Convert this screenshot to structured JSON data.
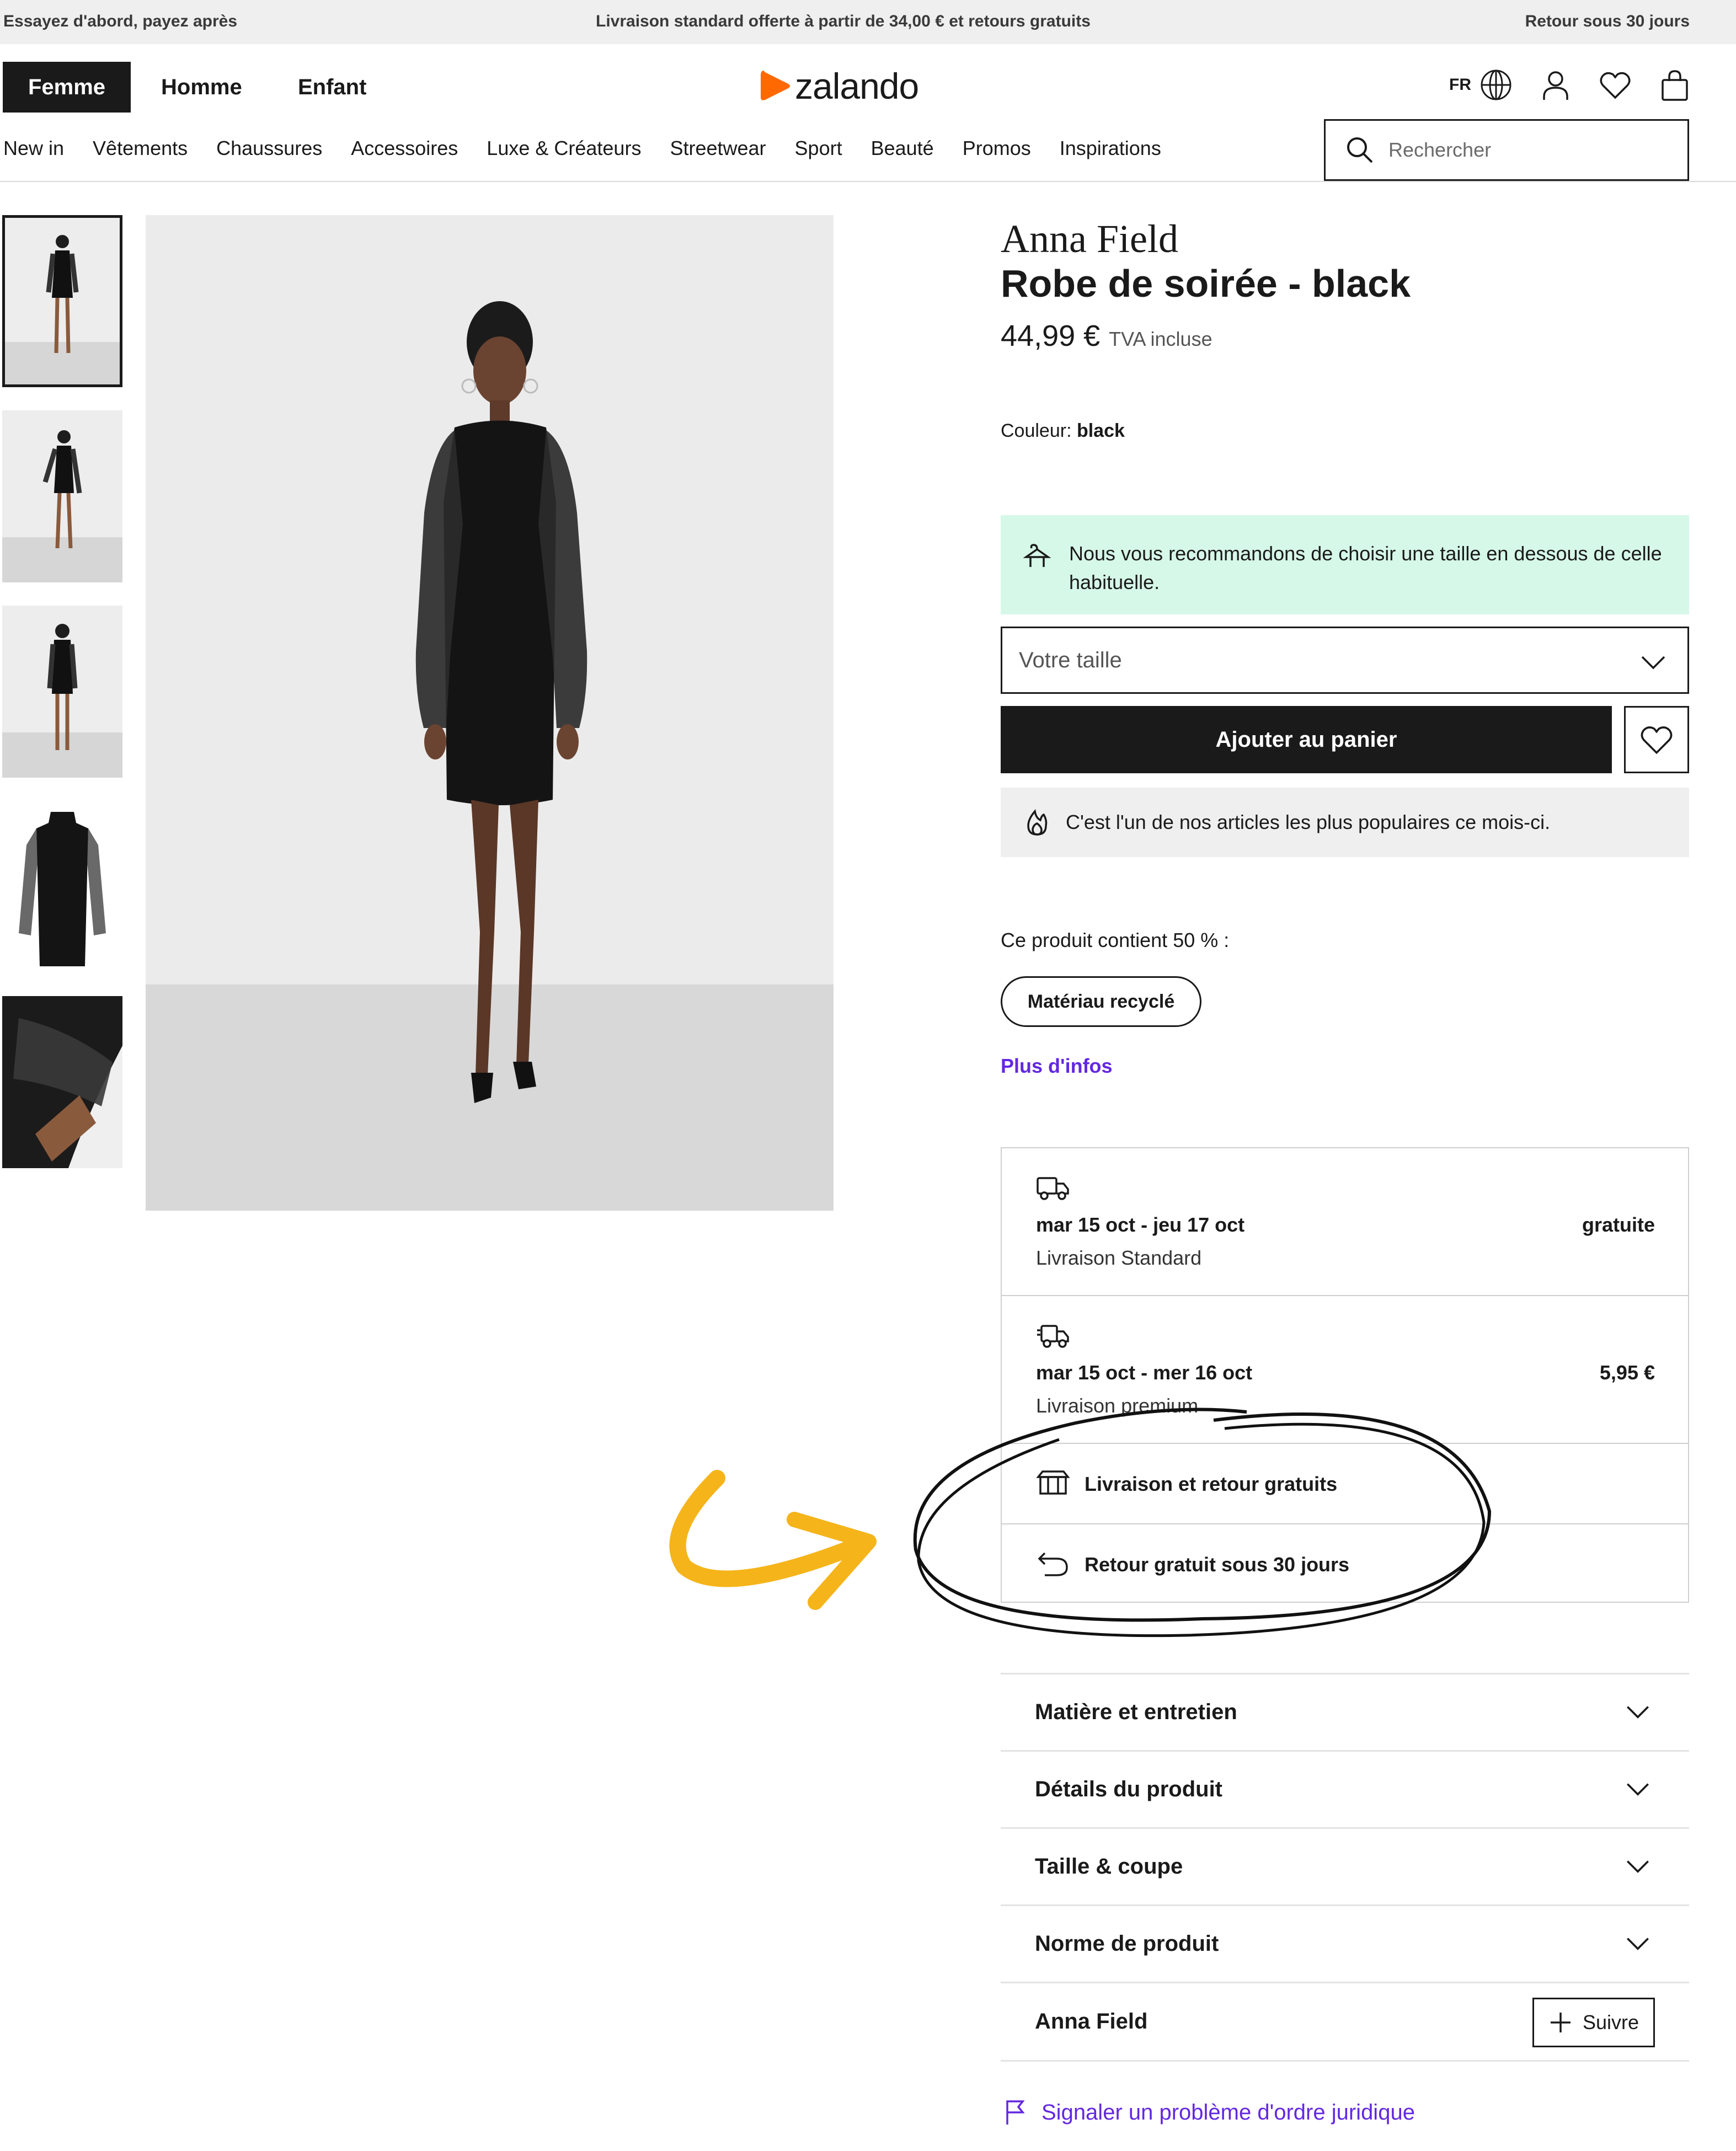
{
  "promo_bar": {
    "left": "Essayez d'abord, payez après",
    "center": "Livraison standard offerte à partir de 34,00 € et retours gratuits",
    "right": "Retour sous 30 jours"
  },
  "header": {
    "genders": [
      "Femme",
      "Homme",
      "Enfant"
    ],
    "active_gender": "Femme",
    "logo_text": "zalando",
    "language": "FR",
    "brand_color": "#ff6900",
    "icons": [
      "globe-icon",
      "account-icon",
      "wishlist-icon",
      "bag-icon"
    ]
  },
  "nav": {
    "items": [
      "New in",
      "Vêtements",
      "Chaussures",
      "Accessoires",
      "Luxe & Créateurs",
      "Streetwear",
      "Sport",
      "Beauté",
      "Promos",
      "Inspirations"
    ]
  },
  "search": {
    "placeholder": "Rechercher"
  },
  "gallery": {
    "thumbnail_count": 5,
    "selected_index": 0
  },
  "product": {
    "brand": "Anna Field",
    "name": "Robe de soirée - black",
    "price": "44,99 €",
    "tax_note": "TVA incluse",
    "color_label": "Couleur:",
    "color_value": "black"
  },
  "size_advice": {
    "text": "Nous vous recommandons de choisir une taille en dessous de celle habituelle.",
    "bg_color": "#d6f8e8"
  },
  "size_select": {
    "placeholder": "Votre taille"
  },
  "cart": {
    "add_label": "Ajouter au panier"
  },
  "popular": {
    "text": "C'est l'un de nos articles les plus populaires ce mois-ci."
  },
  "sustainability": {
    "contains": "Ce produit contient 50 % :",
    "chip": "Matériau recyclé",
    "more_link": "Plus d'infos",
    "link_color": "#6328e0"
  },
  "delivery": {
    "options": [
      {
        "dates": "mar 15 oct - jeu 17 oct",
        "type": "Livraison Standard",
        "cost": "gratuite"
      },
      {
        "dates": "mar 15 oct - mer 16 oct",
        "type": "Livraison premium",
        "cost": "5,95 €"
      }
    ],
    "features": [
      "Livraison et retour gratuits",
      "Retour gratuit sous 30 jours"
    ]
  },
  "accordions": [
    "Matière et entretien",
    "Détails du produit",
    "Taille & coupe",
    "Norme de produit"
  ],
  "brand_follow": {
    "brand": "Anna Field",
    "button": "Suivre"
  },
  "report_link": "Signaler un problème d'ordre juridique",
  "annotation": {
    "arrow_color": "#f5b41a",
    "circle_color": "#111111"
  }
}
